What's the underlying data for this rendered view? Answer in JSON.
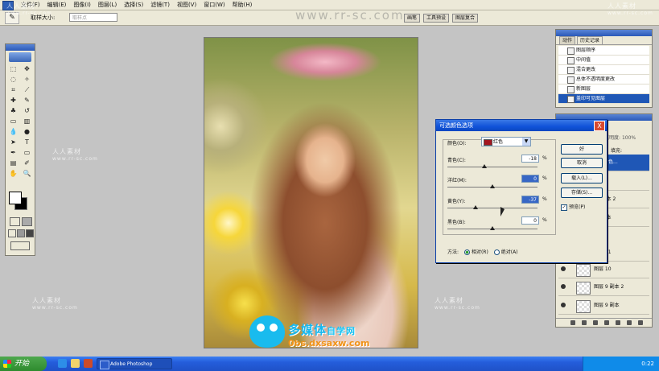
{
  "menubar": {
    "items": [
      "文件(F)",
      "编辑(E)",
      "图像(I)",
      "图层(L)",
      "选择(S)",
      "滤镜(T)",
      "视图(V)",
      "窗口(W)",
      "帮助(H)"
    ]
  },
  "options": {
    "sample_label": "取样大小:",
    "sample_value": "取样点",
    "tabs": [
      "画笔",
      "工具预设",
      "图层复合"
    ]
  },
  "watermarks": {
    "site": "www.rr-sc.com",
    "cn": "人人素材",
    "small": "www.rr-sc.com"
  },
  "history": {
    "tabs": [
      "动作",
      "历史记录"
    ],
    "items": [
      "图层顺序",
      "中间值",
      "混合更改",
      "总体不透明度更改",
      "新图层",
      "盖印可见图层"
    ],
    "selected_index": 5
  },
  "layers": {
    "header_label": "透明度:",
    "header_value": "100%",
    "fill_label": "填充:",
    "rows": [
      "可选颜色...",
      "3",
      "12 副本 2",
      "12 副本",
      "12",
      "图层 11",
      "图层 10",
      "图层 9 副本 2",
      "图层 9 副本"
    ]
  },
  "dialog": {
    "title": "可选颜色选项",
    "close": "X",
    "colors_label": "颜色(O):",
    "color_value": "红色",
    "swatch_color": "#a31620",
    "sliders": [
      {
        "label": "青色(C):",
        "value": "-18",
        "unit": "%",
        "position": 0.41
      },
      {
        "label": "洋红(M):",
        "value": "0",
        "unit": "%",
        "position": 0.5
      },
      {
        "label": "黄色(Y):",
        "value": "-37",
        "unit": "%",
        "position": 0.31
      },
      {
        "label": "黑色(B):",
        "value": "0",
        "unit": "%",
        "position": 0.5
      }
    ],
    "buttons": {
      "ok": "好",
      "cancel": "取消",
      "load": "载入(L)...",
      "save": "存储(S)..."
    },
    "preview_label": "预览(P)",
    "preview_checked": true,
    "method_label": "方法:",
    "method_relative": "相对(R)",
    "method_absolute": "绝对(A)",
    "method_selected": "relative"
  },
  "taskbar": {
    "start": "开始",
    "app_button": "Adobe Photoshop",
    "tray_time": "0:22"
  },
  "brand": {
    "name": "多媒体",
    "suffix": "自学网",
    "url": "0bs.dxsaxw.com"
  }
}
